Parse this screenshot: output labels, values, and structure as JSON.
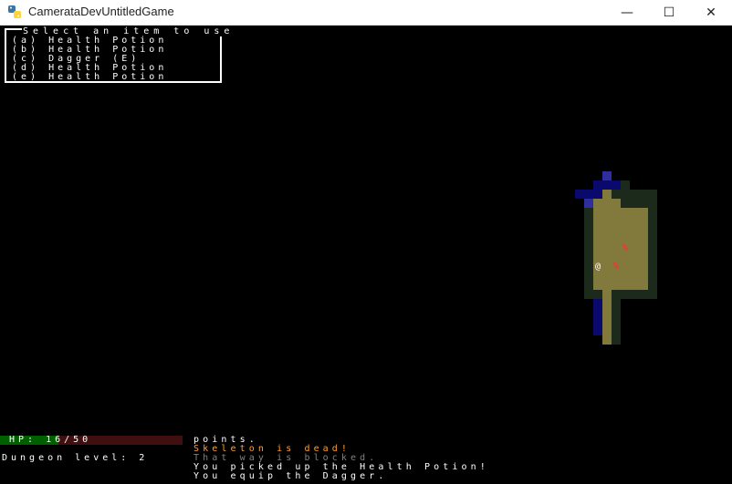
{
  "window": {
    "title": "CamerataDevUntitledGame",
    "minimize_glyph": "—",
    "maximize_glyph": "☐",
    "close_glyph": "✕",
    "icon": "python-icon"
  },
  "inventory_menu": {
    "title": "Select an item to use",
    "items": [
      "(a) Health Potion",
      "(b) Health Potion",
      "(c) Dagger (E)",
      "(d) Health Potion",
      "(e) Health Potion"
    ]
  },
  "status": {
    "hp_text": "HP: 16/50",
    "hp_current": 16,
    "hp_max": 50,
    "dungeon_level_text": "Dungeon level: 2"
  },
  "message_log": [
    {
      "text": "points.",
      "color": "#ffffff"
    },
    {
      "text": "Skeleton is dead!",
      "color": "#ffa030"
    },
    {
      "text": "That way is blocked.",
      "color": "#808080"
    },
    {
      "text": "You picked up the Health Potion!",
      "color": "#ffffff"
    },
    {
      "text": "You equip the Dagger.",
      "color": "#ffffff"
    }
  ],
  "map": {
    "player_glyph": "@",
    "item_glyph": "%",
    "colors": {
      "lit_floor": "#827a3c",
      "dark_wall": "#1c2a1c",
      "explored_floor": "#0a0a6e",
      "explored_wall": "#2e2e9e",
      "item": "#ff2a2a",
      "player": "#ffffff"
    }
  }
}
